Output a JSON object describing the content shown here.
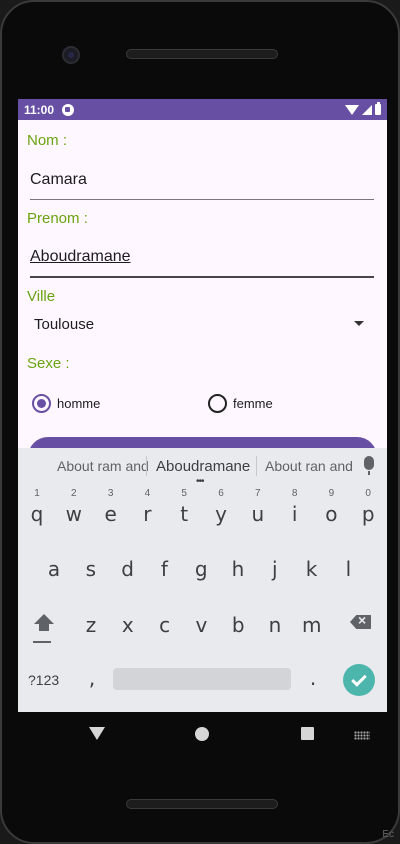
{
  "status": {
    "time": "11:00"
  },
  "form": {
    "nom_label": "Nom :",
    "nom_value": "Camara",
    "prenom_label": "Prenom :",
    "prenom_value": "Aboudramane",
    "ville_label": "Ville",
    "ville_value": "Toulouse",
    "sexe_label": "Sexe :",
    "radio_homme": "homme",
    "radio_femme": "femme",
    "selected_sexe": "homme"
  },
  "keyboard": {
    "suggestions": [
      "About ram and",
      "Aboudramane",
      "About ran and"
    ],
    "row1": [
      "q",
      "w",
      "e",
      "r",
      "t",
      "y",
      "u",
      "i",
      "o",
      "p"
    ],
    "row1_hints": [
      "1",
      "2",
      "3",
      "4",
      "5",
      "6",
      "7",
      "8",
      "9",
      "0"
    ],
    "row2": [
      "a",
      "s",
      "d",
      "f",
      "g",
      "h",
      "j",
      "k",
      "l"
    ],
    "row3": [
      "z",
      "x",
      "c",
      "v",
      "b",
      "n",
      "m"
    ],
    "mode_label": "?123",
    "comma": ",",
    "period": "."
  },
  "colors": {
    "accent": "#6750a4",
    "label_green": "#6aa312",
    "enter_teal": "#4db6ac"
  },
  "corner_text": "Ec"
}
